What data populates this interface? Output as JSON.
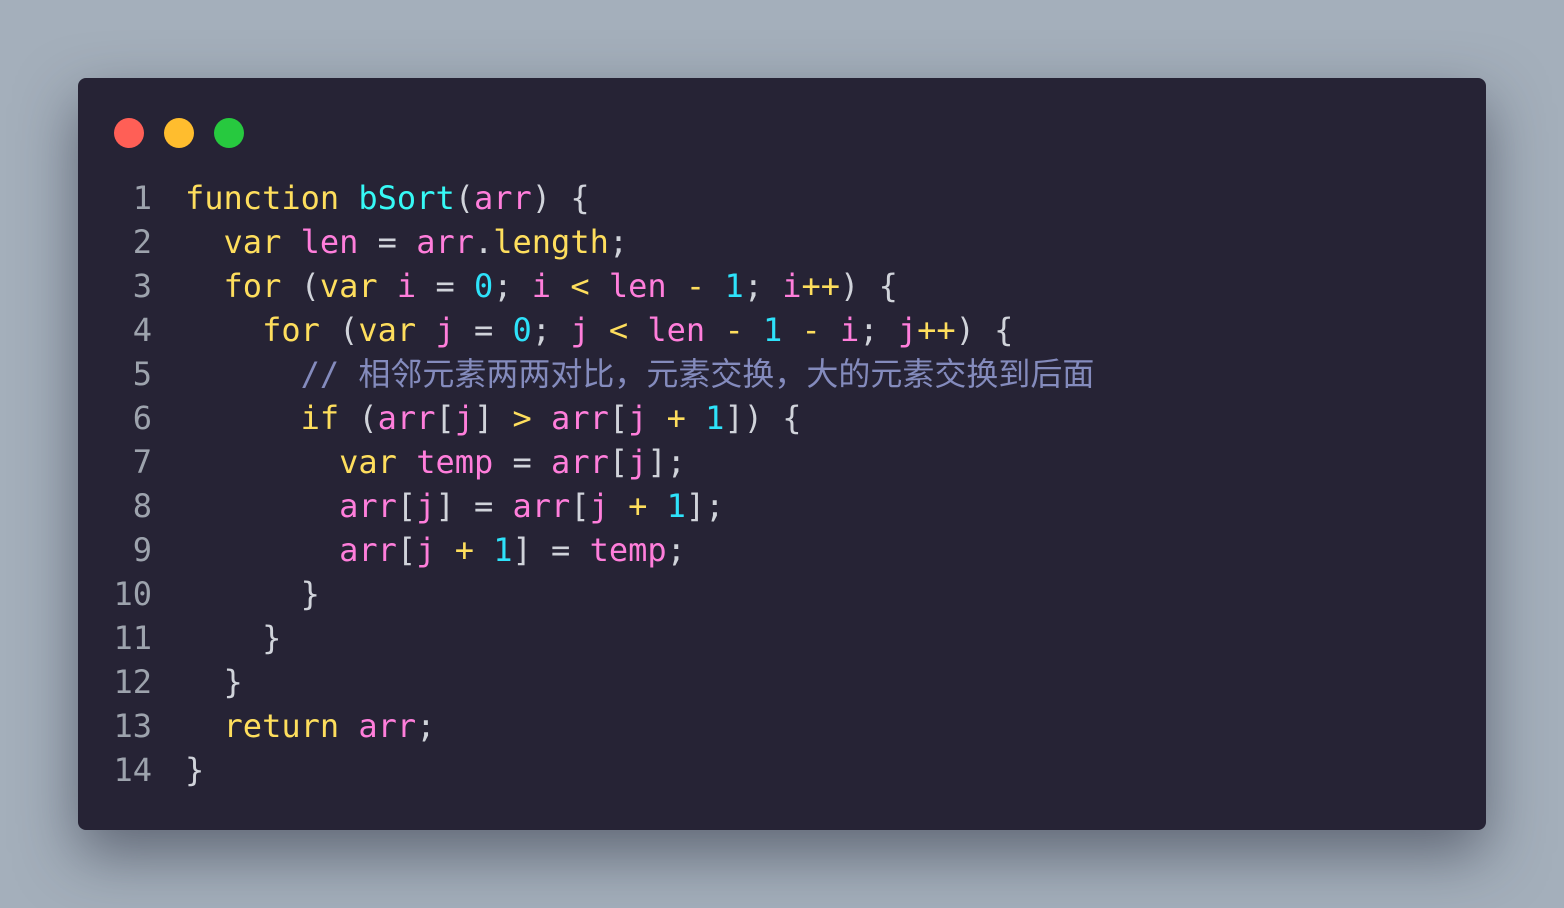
{
  "window": {
    "controls": [
      {
        "name": "close",
        "color": "#ff5f56"
      },
      {
        "name": "minimize",
        "color": "#ffbd2e"
      },
      {
        "name": "maximize",
        "color": "#27c93f"
      }
    ]
  },
  "code": {
    "language": "javascript",
    "lines": [
      {
        "n": "1",
        "tokens": [
          [
            "kw",
            "function"
          ],
          [
            "pu",
            " "
          ],
          [
            "fn",
            "bSort"
          ],
          [
            "pu",
            "("
          ],
          [
            "id",
            "arr"
          ],
          [
            "pu",
            ") {"
          ]
        ]
      },
      {
        "n": "2",
        "tokens": [
          [
            "pu",
            "  "
          ],
          [
            "kw",
            "var"
          ],
          [
            "pu",
            " "
          ],
          [
            "id",
            "len"
          ],
          [
            "pu",
            " = "
          ],
          [
            "id",
            "arr"
          ],
          [
            "pu",
            "."
          ],
          [
            "kw",
            "length"
          ],
          [
            "pu",
            ";"
          ]
        ]
      },
      {
        "n": "3",
        "tokens": [
          [
            "pu",
            "  "
          ],
          [
            "kw",
            "for"
          ],
          [
            "pu",
            " ("
          ],
          [
            "kw",
            "var"
          ],
          [
            "pu",
            " "
          ],
          [
            "id",
            "i"
          ],
          [
            "pu",
            " = "
          ],
          [
            "num",
            "0"
          ],
          [
            "pu",
            "; "
          ],
          [
            "id",
            "i"
          ],
          [
            "pu",
            " "
          ],
          [
            "kw",
            "<"
          ],
          [
            "pu",
            " "
          ],
          [
            "id",
            "len"
          ],
          [
            "pu",
            " "
          ],
          [
            "kw",
            "-"
          ],
          [
            "pu",
            " "
          ],
          [
            "num",
            "1"
          ],
          [
            "pu",
            "; "
          ],
          [
            "id",
            "i"
          ],
          [
            "kw",
            "++"
          ],
          [
            "pu",
            ") {"
          ]
        ]
      },
      {
        "n": "4",
        "tokens": [
          [
            "pu",
            "    "
          ],
          [
            "kw",
            "for"
          ],
          [
            "pu",
            " ("
          ],
          [
            "kw",
            "var"
          ],
          [
            "pu",
            " "
          ],
          [
            "id",
            "j"
          ],
          [
            "pu",
            " = "
          ],
          [
            "num",
            "0"
          ],
          [
            "pu",
            "; "
          ],
          [
            "id",
            "j"
          ],
          [
            "pu",
            " "
          ],
          [
            "kw",
            "<"
          ],
          [
            "pu",
            " "
          ],
          [
            "id",
            "len"
          ],
          [
            "pu",
            " "
          ],
          [
            "kw",
            "-"
          ],
          [
            "pu",
            " "
          ],
          [
            "num",
            "1"
          ],
          [
            "pu",
            " "
          ],
          [
            "kw",
            "-"
          ],
          [
            "pu",
            " "
          ],
          [
            "id",
            "i"
          ],
          [
            "pu",
            "; "
          ],
          [
            "id",
            "j"
          ],
          [
            "kw",
            "++"
          ],
          [
            "pu",
            ") {"
          ]
        ]
      },
      {
        "n": "5",
        "tokens": [
          [
            "pu",
            "      "
          ],
          [
            "cm",
            "// 相邻元素两两对比，元素交换，大的元素交换到后面"
          ]
        ]
      },
      {
        "n": "6",
        "tokens": [
          [
            "pu",
            "      "
          ],
          [
            "kw",
            "if"
          ],
          [
            "pu",
            " ("
          ],
          [
            "id",
            "arr"
          ],
          [
            "pu",
            "["
          ],
          [
            "id",
            "j"
          ],
          [
            "pu",
            "] "
          ],
          [
            "kw",
            ">"
          ],
          [
            "pu",
            " "
          ],
          [
            "id",
            "arr"
          ],
          [
            "pu",
            "["
          ],
          [
            "id",
            "j"
          ],
          [
            "pu",
            " "
          ],
          [
            "kw",
            "+"
          ],
          [
            "pu",
            " "
          ],
          [
            "num",
            "1"
          ],
          [
            "pu",
            "]) {"
          ]
        ]
      },
      {
        "n": "7",
        "tokens": [
          [
            "pu",
            "        "
          ],
          [
            "kw",
            "var"
          ],
          [
            "pu",
            " "
          ],
          [
            "id",
            "temp"
          ],
          [
            "pu",
            " = "
          ],
          [
            "id",
            "arr"
          ],
          [
            "pu",
            "["
          ],
          [
            "id",
            "j"
          ],
          [
            "pu",
            "];"
          ]
        ]
      },
      {
        "n": "8",
        "tokens": [
          [
            "pu",
            "        "
          ],
          [
            "id",
            "arr"
          ],
          [
            "pu",
            "["
          ],
          [
            "id",
            "j"
          ],
          [
            "pu",
            "] = "
          ],
          [
            "id",
            "arr"
          ],
          [
            "pu",
            "["
          ],
          [
            "id",
            "j"
          ],
          [
            "pu",
            " "
          ],
          [
            "kw",
            "+"
          ],
          [
            "pu",
            " "
          ],
          [
            "num",
            "1"
          ],
          [
            "pu",
            "];"
          ]
        ]
      },
      {
        "n": "9",
        "tokens": [
          [
            "pu",
            "        "
          ],
          [
            "id",
            "arr"
          ],
          [
            "pu",
            "["
          ],
          [
            "id",
            "j"
          ],
          [
            "pu",
            " "
          ],
          [
            "kw",
            "+"
          ],
          [
            "pu",
            " "
          ],
          [
            "num",
            "1"
          ],
          [
            "pu",
            "] = "
          ],
          [
            "id",
            "temp"
          ],
          [
            "pu",
            ";"
          ]
        ]
      },
      {
        "n": "10",
        "tokens": [
          [
            "pu",
            "      }"
          ]
        ]
      },
      {
        "n": "11",
        "tokens": [
          [
            "pu",
            "    }"
          ]
        ]
      },
      {
        "n": "12",
        "tokens": [
          [
            "pu",
            "  }"
          ]
        ]
      },
      {
        "n": "13",
        "tokens": [
          [
            "pu",
            "  "
          ],
          [
            "kw",
            "return"
          ],
          [
            "pu",
            " "
          ],
          [
            "id",
            "arr"
          ],
          [
            "pu",
            ";"
          ]
        ]
      },
      {
        "n": "14",
        "tokens": [
          [
            "pu",
            "}"
          ]
        ]
      }
    ]
  }
}
